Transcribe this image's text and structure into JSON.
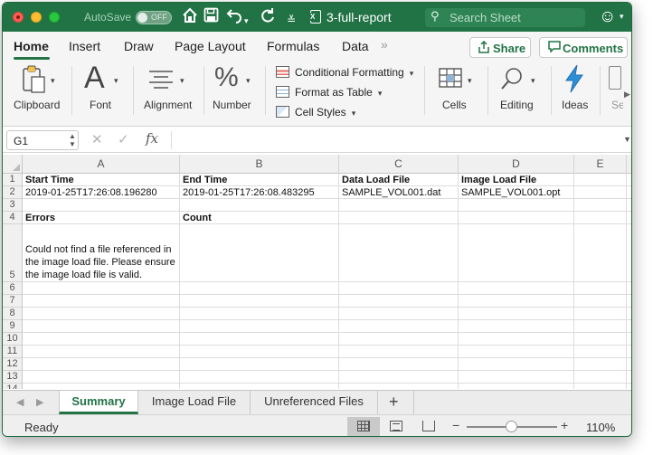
{
  "titlebar": {
    "autosave_label": "AutoSave",
    "autosave_state": "OFF",
    "document_title": "3-full-report",
    "search_placeholder": "Search Sheet"
  },
  "ribbon_tabs": {
    "tabs": [
      "Home",
      "Insert",
      "Draw",
      "Page Layout",
      "Formulas",
      "Data"
    ],
    "active": "Home",
    "share_label": "Share",
    "comments_label": "Comments"
  },
  "ribbon": {
    "clipboard": "Clipboard",
    "font": "Font",
    "alignment": "Alignment",
    "number": "Number",
    "conditional_formatting": "Conditional Formatting",
    "format_as_table": "Format as Table",
    "cell_styles": "Cell Styles",
    "cells": "Cells",
    "editing": "Editing",
    "ideas": "Ideas",
    "cut_off_label": "Se"
  },
  "formula_bar": {
    "name_box": "G1",
    "fx_label": "fx",
    "formula": ""
  },
  "sheet": {
    "columns": [
      "A",
      "B",
      "C",
      "D",
      "E"
    ],
    "rows": [
      "1",
      "2",
      "3",
      "4",
      "5",
      "6",
      "7",
      "8",
      "9",
      "10",
      "11",
      "12",
      "13",
      "14"
    ],
    "cells": {
      "A1": "Start Time",
      "B1": "End Time",
      "C1": "Data Load File",
      "D1": "Image Load File",
      "A2": "2019-01-25T17:26:08.196280",
      "B2": "2019-01-25T17:26:08.483295",
      "C2": "SAMPLE_VOL001.dat",
      "D2": "SAMPLE_VOL001.opt",
      "A4": "Errors",
      "B4": "Count",
      "A5": "Could not find a file referenced in the image load file. Please ensure the image load file is valid."
    }
  },
  "sheet_tabs": {
    "tabs": [
      "Summary",
      "Image Load File",
      "Unreferenced Files"
    ],
    "active": "Summary",
    "add_label": "+"
  },
  "status_bar": {
    "status": "Ready",
    "zoom": "110%",
    "zoom_level_percent": 110,
    "active_view": "normal"
  },
  "colors": {
    "brand_green": "#217346",
    "title_text": "#ffffff"
  }
}
